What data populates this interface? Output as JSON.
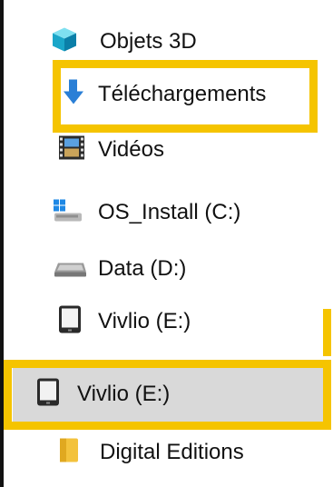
{
  "tree": {
    "items": [
      {
        "label": "Objets 3D",
        "icon": "cube-3d-icon"
      },
      {
        "label": "Téléchargements",
        "icon": "download-arrow-icon",
        "highlighted": true
      },
      {
        "label": "Vidéos",
        "icon": "film-strip-icon"
      },
      {
        "label": "OS_Install (C:)",
        "icon": "windows-drive-icon"
      },
      {
        "label": "Data (D:)",
        "icon": "hard-drive-icon"
      },
      {
        "label": "Vivlio (E:)",
        "icon": "ereader-icon"
      },
      {
        "label": "Vivlio (E:)",
        "icon": "ereader-icon",
        "selected": true,
        "highlighted": true
      },
      {
        "label": "Digital Editions",
        "icon": "folder-icon"
      }
    ]
  },
  "colors": {
    "highlight": "#f5c400",
    "selection": "#d9d9d9",
    "download_arrow": "#2a7fd6",
    "folder": "#f3c23c"
  }
}
